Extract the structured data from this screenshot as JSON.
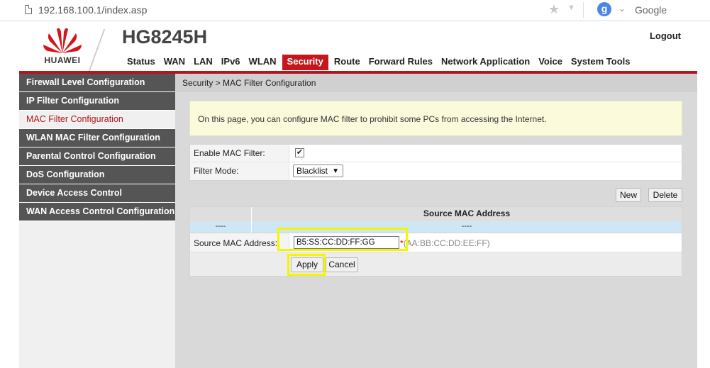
{
  "browser": {
    "url": "192.168.100.1/index.asp",
    "search_engine": "Google",
    "search_icon_letter": "g"
  },
  "header": {
    "brand": "HUAWEI",
    "product": "HG8245H",
    "logout": "Logout",
    "nav": [
      "Status",
      "WAN",
      "LAN",
      "IPv6",
      "WLAN",
      "Security",
      "Route",
      "Forward Rules",
      "Network Application",
      "Voice",
      "System Tools"
    ],
    "active_nav": "Security"
  },
  "sidebar": {
    "items": [
      "Firewall Level Configuration",
      "IP Filter Configuration",
      "MAC Filter Configuration",
      "WLAN MAC Filter Configuration",
      "Parental Control Configuration",
      "DoS Configuration",
      "Device Access Control",
      "WAN Access Control Configuration"
    ],
    "active_item": "MAC Filter Configuration"
  },
  "main": {
    "breadcrumb": "Security > MAC Filter Configuration",
    "info": "On this page, you can configure MAC filter to prohibit some PCs from accessing the Internet.",
    "enable_label": "Enable MAC Filter:",
    "enable_checked": "✔",
    "filter_mode_label": "Filter Mode:",
    "filter_mode_value": "Blacklist",
    "new_button": "New",
    "delete_button": "Delete",
    "list_header": "Source MAC Address",
    "list_row": [
      "----",
      "----"
    ],
    "source_mac_label": "Source MAC Address:",
    "source_mac_value": "B5:SS:CC:DD:FF:GG",
    "source_mac_required": "*",
    "source_mac_hint": "(AA:BB:CC:DD:EE:FF)",
    "apply_button": "Apply",
    "cancel_button": "Cancel"
  },
  "colors": {
    "accent_red": "#c4171d",
    "sidebar_gray": "#555555",
    "highlight_yellow": "#f5f500"
  }
}
